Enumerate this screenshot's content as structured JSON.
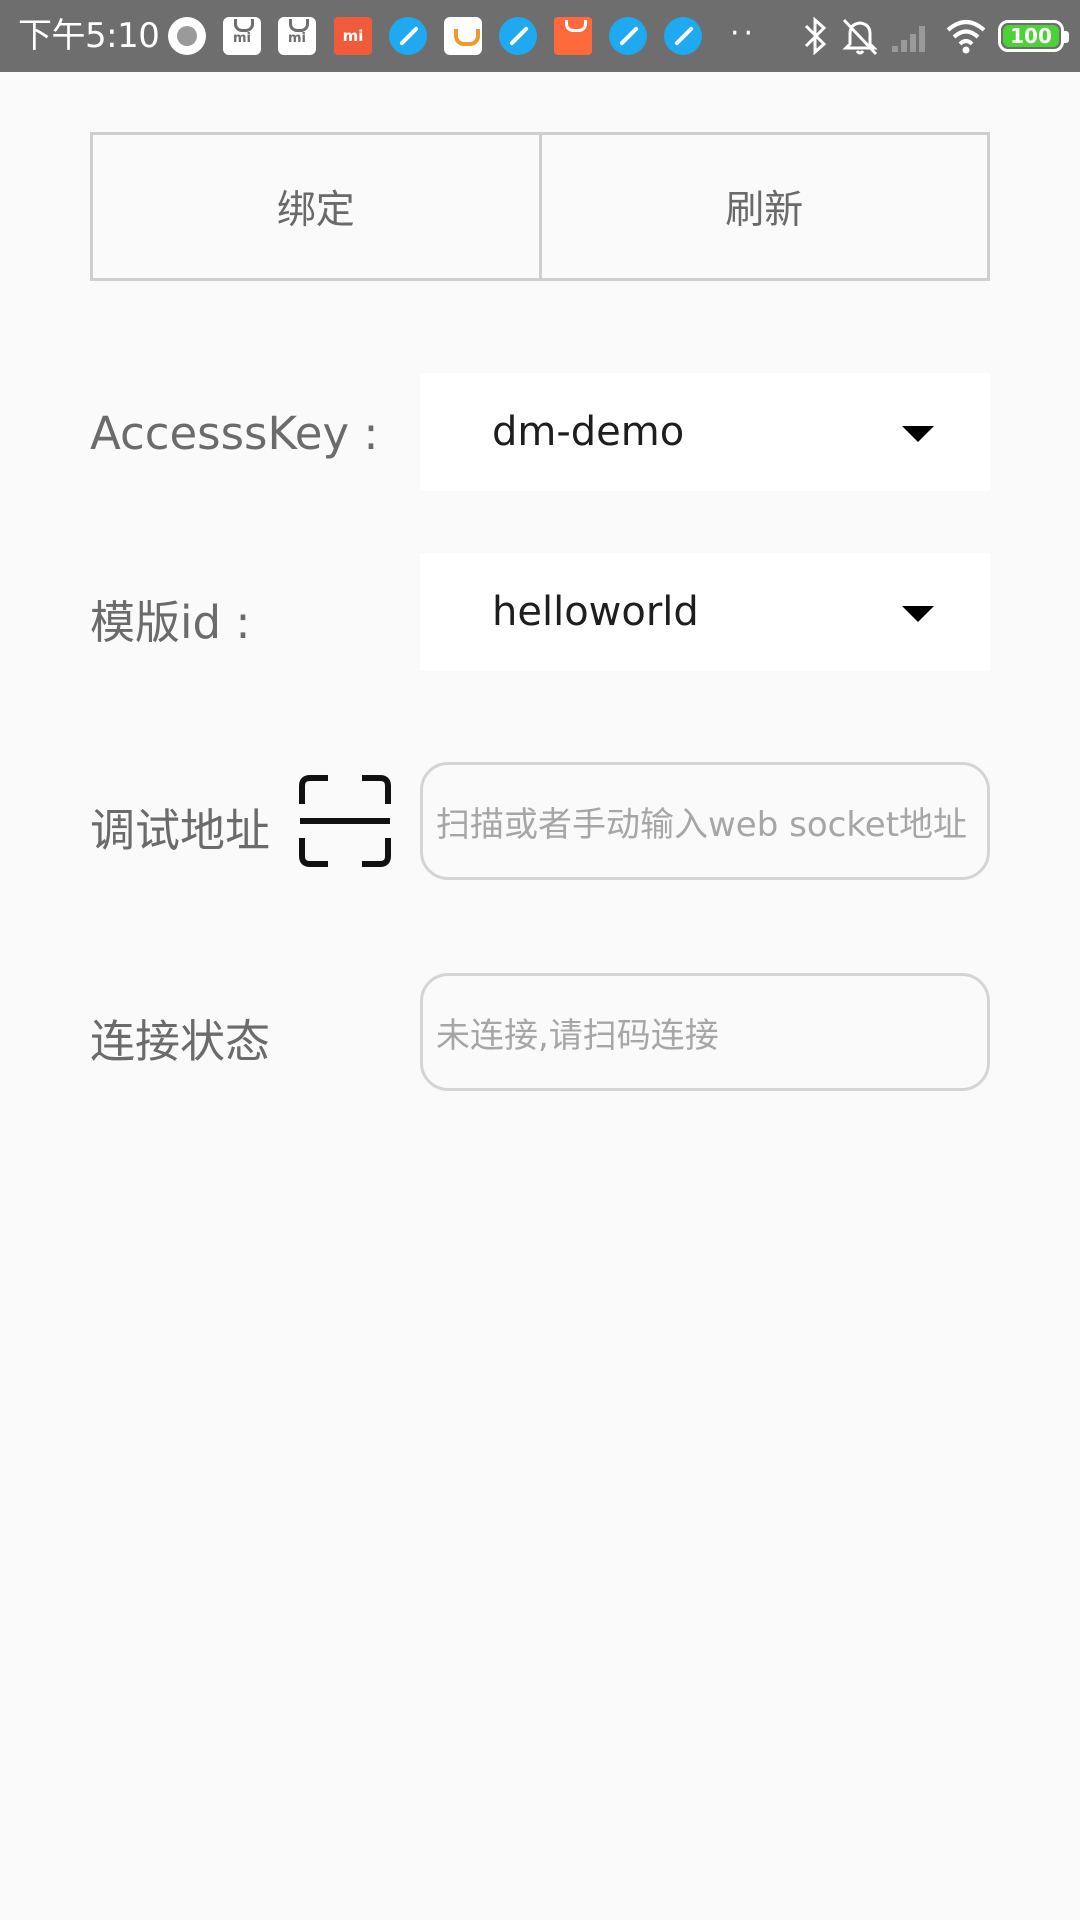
{
  "status_bar": {
    "time": "下午5:10",
    "battery": "100",
    "notification_icons": [
      "circle-app-icon",
      "mi-store-icon",
      "mi-store-icon",
      "mi-icon",
      "blue-browser-icon",
      "didi-icon",
      "blue-browser-icon",
      "shop-icon",
      "blue-browser-icon",
      "blue-browser-icon"
    ],
    "more_indicator": "··",
    "system_icons": [
      "bluetooth-icon",
      "mute-icon",
      "signal-icon",
      "wifi-icon",
      "battery-icon"
    ]
  },
  "toolbar": {
    "bind_label": "绑定",
    "refresh_label": "刷新"
  },
  "form": {
    "access_key": {
      "label": "AccesssKey :",
      "value": "dm-demo"
    },
    "template_id": {
      "label": "模版id :",
      "value": "helloworld"
    },
    "debug_address": {
      "label": "调试地址",
      "placeholder": "扫描或者手动输入web socket地址",
      "scan_icon": "scan-icon"
    },
    "connection_status": {
      "label": "连接状态",
      "placeholder": "未连接,请扫码连接"
    }
  },
  "colors": {
    "status_bar_bg": "#6e6e6e",
    "page_bg": "#fafafa",
    "label_text": "#6b6b6b",
    "placeholder_text": "#a6a6a6",
    "border": "#cfcfcf",
    "battery_green": "#4cd137"
  }
}
